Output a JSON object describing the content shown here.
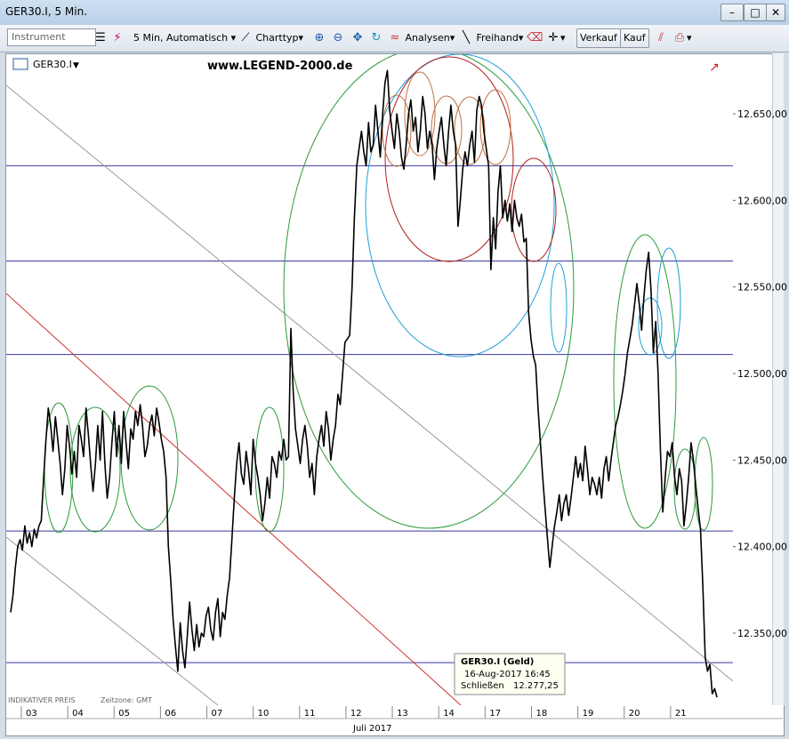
{
  "window": {
    "title": "GER30.I, 5 Min.",
    "title_buttons": [
      "",
      "",
      ""
    ]
  },
  "toolbar": {
    "instrument_placeholder": "Instrument",
    "timeframe_label": "5 Min,  Automatisch",
    "charttyp_label": "Charttyp",
    "analysen_label": "Analysen",
    "freihand_label": "Freihand",
    "verkauf_label": "Verkauf",
    "kauf_label": "Kauf"
  },
  "chart_header": {
    "symbol_label": "GER30.I",
    "watermark": "www.LEGEND-2000.de"
  },
  "footer": {
    "indikativer": "INDIKATIVER PREIS",
    "zeitzone": "Zeitzone: GMT",
    "month_label": "Juli 2017"
  },
  "tooltip": {
    "title": "GER30.I (Geld)",
    "datetime": "16-Aug-2017 16:45",
    "close_label": "Schließen",
    "close_value": "12.277,25"
  },
  "chart_data": {
    "type": "line",
    "ylim": [
      12300,
      12680
    ],
    "y_ticks": [
      "12.650,00",
      "12.600,00",
      "12.550,00",
      "12.500,00",
      "12.450,00",
      "12.400,00",
      "12.350,00"
    ],
    "y_tick_values": [
      12650,
      12600,
      12550,
      12500,
      12450,
      12400,
      12350
    ],
    "x_ticks": [
      "03",
      "04",
      "05",
      "06",
      "07",
      "10",
      "11",
      "12",
      "13",
      "14",
      "17",
      "18",
      "19",
      "20",
      "21"
    ],
    "horizontal_levels": [
      12620,
      12565,
      12511,
      12409,
      12333
    ],
    "series": [
      {
        "values": [
          12362,
          12372,
          12388,
          12400,
          12404,
          12398,
          12412,
          12402,
          12408,
          12400,
          12410,
          12405,
          12412,
          12415,
          12440,
          12462,
          12480,
          12470,
          12455,
          12475,
          12462,
          12448,
          12430,
          12445,
          12470,
          12458,
          12442,
          12455,
          12440,
          12470,
          12462,
          12452,
          12480,
          12465,
          12447,
          12432,
          12448,
          12470,
          12450,
          12478,
          12448,
          12428,
          12440,
          12460,
          12478,
          12452,
          12470,
          12448,
          12478,
          12460,
          12445,
          12468,
          12462,
          12478,
          12470,
          12482,
          12470,
          12452,
          12458,
          12470,
          12476,
          12464,
          12480,
          12472,
          12462,
          12455,
          12440,
          12400,
          12380,
          12358,
          12342,
          12328,
          12356,
          12340,
          12330,
          12348,
          12368,
          12352,
          12340,
          12355,
          12342,
          12350,
          12348,
          12360,
          12365,
          12352,
          12346,
          12362,
          12370,
          12348,
          12362,
          12358,
          12372,
          12382,
          12405,
          12428,
          12448,
          12460,
          12442,
          12436,
          12455,
          12445,
          12430,
          12462,
          12448,
          12440,
          12430,
          12415,
          12425,
          12440,
          12428,
          12452,
          12448,
          12440,
          12455,
          12450,
          12462,
          12450,
          12452,
          12526,
          12490,
          12468,
          12458,
          12448,
          12462,
          12470,
          12458,
          12440,
          12448,
          12430,
          12452,
          12462,
          12470,
          12458,
          12478,
          12468,
          12450,
          12462,
          12470,
          12488,
          12482,
          12500,
          12518,
          12520,
          12522,
          12550,
          12590,
          12620,
          12630,
          12640,
          12628,
          12620,
          12645,
          12628,
          12632,
          12655,
          12640,
          12625,
          12650,
          12668,
          12675,
          12652,
          12640,
          12630,
          12650,
          12640,
          12625,
          12618,
          12632,
          12650,
          12658,
          12640,
          12648,
          12628,
          12640,
          12660,
          12650,
          12630,
          12640,
          12632,
          12612,
          12630,
          12640,
          12648,
          12632,
          12620,
          12640,
          12655,
          12640,
          12632,
          12585,
          12600,
          12618,
          12628,
          12620,
          12632,
          12640,
          12622,
          12652,
          12660,
          12655,
          12640,
          12630,
          12620,
          12560,
          12590,
          12572,
          12605,
          12620,
          12590,
          12600,
          12588,
          12598,
          12582,
          12600,
          12590,
          12585,
          12592,
          12576,
          12578,
          12535,
          12520,
          12510,
          12505,
          12480,
          12460,
          12440,
          12422,
          12405,
          12388,
          12400,
          12412,
          12420,
          12430,
          12415,
          12425,
          12430,
          12418,
          12428,
          12440,
          12452,
          12440,
          12448,
          12438,
          12458,
          12445,
          12430,
          12440,
          12436,
          12430,
          12440,
          12428,
          12445,
          12452,
          12438,
          12450,
          12460,
          12470,
          12475,
          12482,
          12490,
          12500,
          12512,
          12520,
          12528,
          12540,
          12552,
          12540,
          12525,
          12545,
          12560,
          12570,
          12548,
          12512,
          12530,
          12500,
          12455,
          12420,
          12440,
          12455,
          12452,
          12460,
          12440,
          12430,
          12445,
          12438,
          12412,
          12425,
          12440,
          12460,
          12450,
          12435,
          12422,
          12410,
          12378,
          12336,
          12328,
          12332,
          12315,
          12318,
          12313
        ]
      }
    ]
  }
}
